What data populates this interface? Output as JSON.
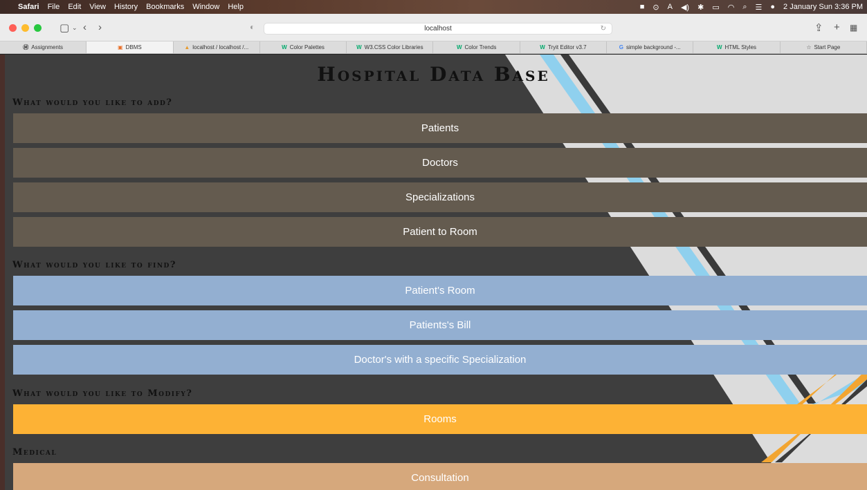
{
  "menubar": {
    "app": "Safari",
    "items": [
      "File",
      "Edit",
      "View",
      "History",
      "Bookmarks",
      "Window",
      "Help"
    ],
    "datetime": "2 January Sun  3:36 PM"
  },
  "toolbar": {
    "address": "localhost"
  },
  "tabs": [
    {
      "label": "Assignments",
      "icon": "m-logo"
    },
    {
      "label": "DBMS",
      "icon": "box-logo"
    },
    {
      "label": "localhost / localhost /...",
      "icon": "phpmyadmin-logo"
    },
    {
      "label": "Color Palettes",
      "icon": "w3-logo"
    },
    {
      "label": "W3.CSS Color Libraries",
      "icon": "w3-logo"
    },
    {
      "label": "Color Trends",
      "icon": "w3-logo"
    },
    {
      "label": "Tryit Editor v3.7",
      "icon": "w3-logo"
    },
    {
      "label": "simple background -...",
      "icon": "google-logo"
    },
    {
      "label": "HTML Styles",
      "icon": "w3-logo"
    },
    {
      "label": "Start Page",
      "icon": "star"
    }
  ],
  "page": {
    "title": "Hospital Data Base",
    "add_heading": "What would you like to add?",
    "add_buttons": [
      "Patients",
      "Doctors",
      "Specializations",
      "Patient to Room"
    ],
    "find_heading": "What would you like to find?",
    "find_buttons": [
      "Patient's Room",
      "Patients's Bill",
      "Doctor's with a specific Specialization"
    ],
    "modify_heading": "What would you like to Modify?",
    "modify_buttons": [
      "Rooms"
    ],
    "medical_heading": "Medical",
    "medical_buttons": [
      "Consultation"
    ]
  },
  "colors": {
    "add": "#645b4f",
    "find": "#93afd1",
    "modify": "#fdb235",
    "medical": "#d6a87c",
    "background": "#3e3e3e"
  }
}
